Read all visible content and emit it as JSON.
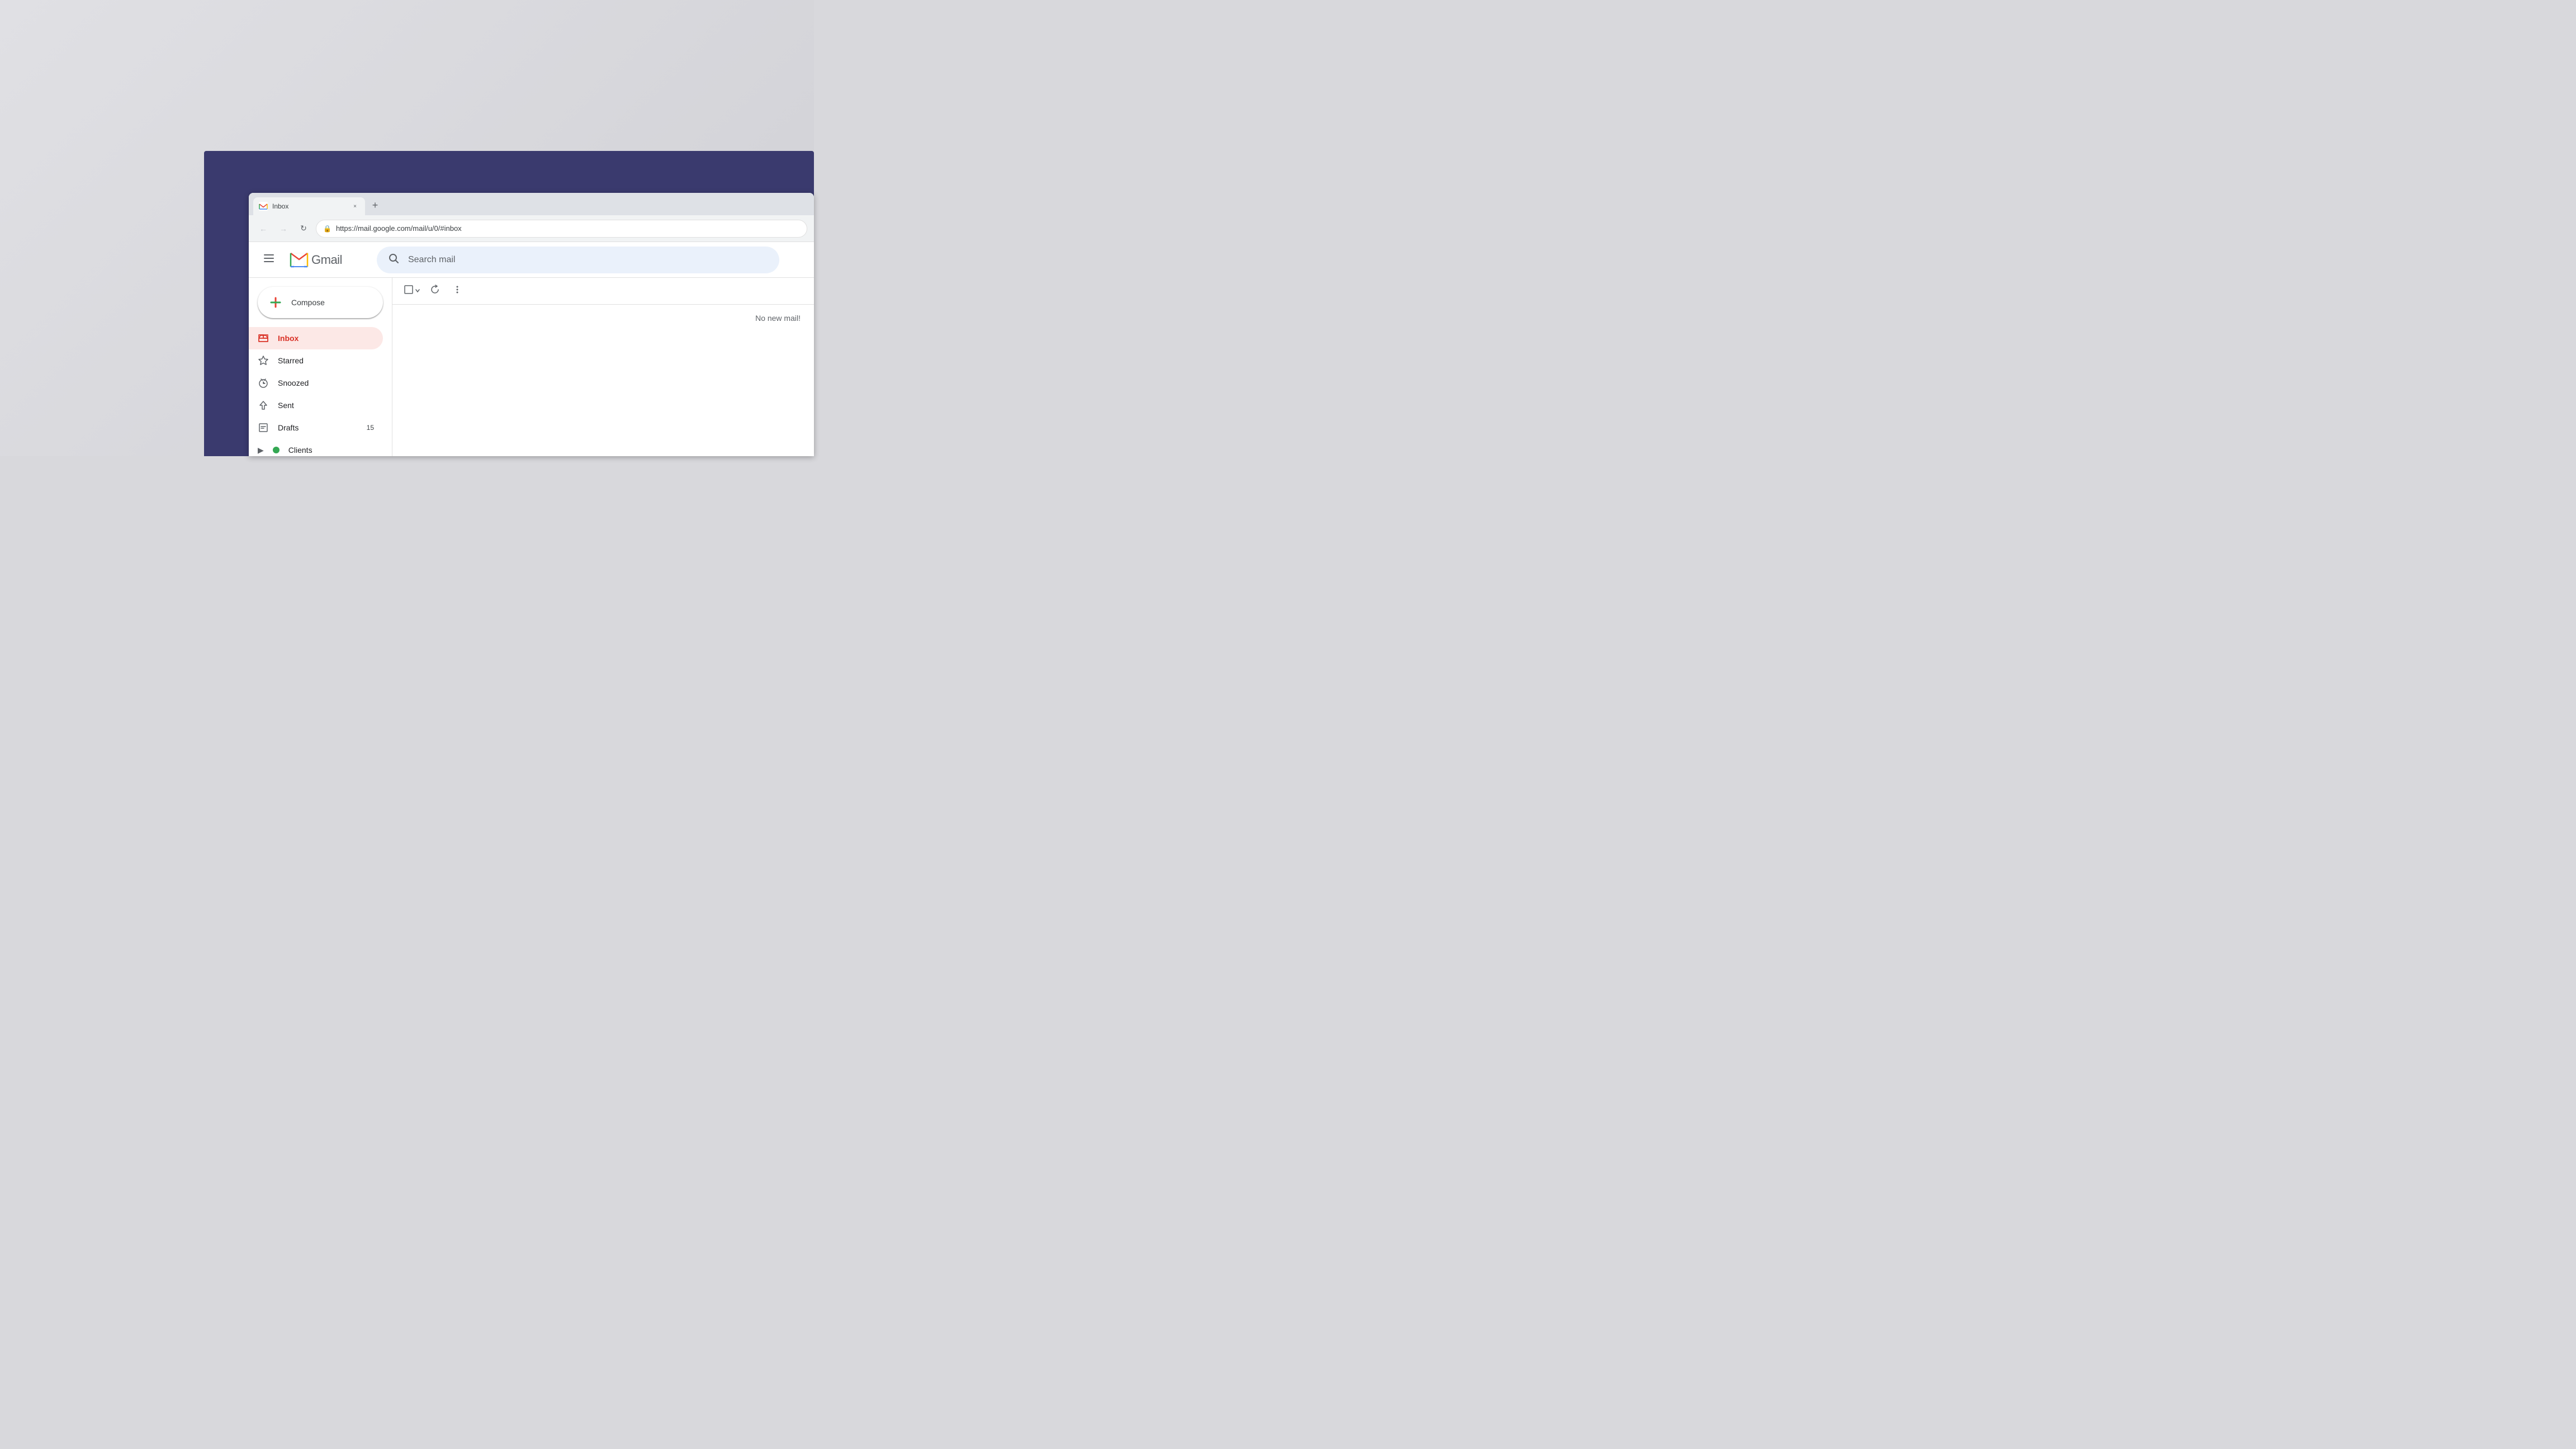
{
  "desktop": {
    "background": "#d8d8dc"
  },
  "browser": {
    "tab": {
      "favicon": "M",
      "title": "Inbox",
      "close_label": "×"
    },
    "new_tab_label": "+",
    "nav": {
      "back_disabled": true,
      "forward_disabled": true,
      "refresh_label": "↻"
    },
    "address_bar": {
      "lock_icon": "🔒",
      "url": "https://mail.google.com/mail/u/0/#inbox"
    }
  },
  "gmail": {
    "header": {
      "menu_icon": "☰",
      "logo_text": "Gmail",
      "search_placeholder": "Search mail"
    },
    "sidebar": {
      "compose_label": "Compose",
      "nav_items": [
        {
          "id": "inbox",
          "label": "Inbox",
          "icon": "inbox",
          "active": true,
          "badge": ""
        },
        {
          "id": "starred",
          "label": "Starred",
          "icon": "star",
          "active": false,
          "badge": ""
        },
        {
          "id": "snoozed",
          "label": "Snoozed",
          "icon": "clock",
          "active": false,
          "badge": ""
        },
        {
          "id": "sent",
          "label": "Sent",
          "icon": "send",
          "active": false,
          "badge": ""
        },
        {
          "id": "drafts",
          "label": "Drafts",
          "icon": "draft",
          "active": false,
          "badge": "15"
        },
        {
          "id": "clients",
          "label": "Clients",
          "icon": "folder",
          "active": false,
          "badge": "",
          "expandable": true,
          "color": "#34a853"
        }
      ]
    },
    "main": {
      "toolbar": {
        "select_label": "□",
        "chevron_label": "▾",
        "refresh_label": "↻",
        "more_label": "⋮"
      },
      "empty_state_text": "No new mail!"
    }
  }
}
